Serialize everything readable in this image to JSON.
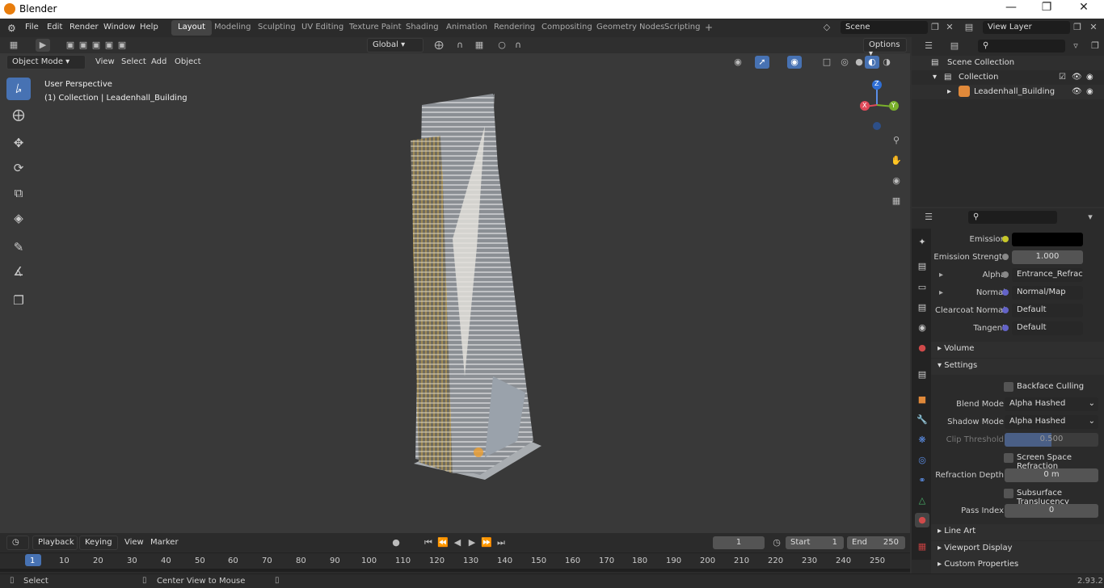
{
  "app": {
    "title": "Blender",
    "version": "2.93.2"
  },
  "menus": [
    "File",
    "Edit",
    "Render",
    "Window",
    "Help"
  ],
  "workspaces": [
    "Layout",
    "Modeling",
    "Sculpting",
    "UV Editing",
    "Texture Paint",
    "Shading",
    "Animation",
    "Rendering",
    "Compositing",
    "Geometry Nodes",
    "Scripting"
  ],
  "active_workspace": "Layout",
  "scene": {
    "name": "Scene",
    "view_layer": "View Layer"
  },
  "header": {
    "transform": "Global",
    "options": "Options"
  },
  "viewport": {
    "mode": "Object Mode",
    "menu": [
      "View",
      "Select",
      "Add",
      "Object"
    ],
    "perspective": "User Perspective",
    "collection_info": "(1) Collection | Leadenhall_Building",
    "gizmo": {
      "x": "X",
      "y": "Y",
      "z": "Z"
    }
  },
  "outliner": {
    "root": "Scene Collection",
    "collection": "Collection",
    "object": "Leadenhall_Building"
  },
  "properties": {
    "emission_label": "Emission",
    "emission_strength_label": "Emission Strengt",
    "emission_strength_value": "1.000",
    "alpha_label": "Alpha",
    "alpha_value": "Entrance_Refract_in...",
    "normal_label": "Normal",
    "normal_value": "Normal/Map",
    "clearcoat_label": "Clearcoat Normal",
    "clearcoat_value": "Default",
    "tangent_label": "Tangent",
    "tangent_value": "Default",
    "volume": "Volume",
    "settings": "Settings",
    "backface": "Backface Culling",
    "blend_label": "Blend Mode",
    "blend_value": "Alpha Hashed",
    "shadow_label": "Shadow Mode",
    "shadow_value": "Alpha Hashed",
    "clip_label": "Clip Threshold",
    "clip_value": "0.500",
    "ssr": "Screen Space Refraction",
    "refraction_label": "Refraction Depth",
    "refraction_value": "0 m",
    "sss": "Subsurface Translucency",
    "pass_label": "Pass Index",
    "pass_value": "0",
    "line_art": "Line Art",
    "viewport_display": "Viewport Display",
    "custom_props": "Custom Properties"
  },
  "timeline": {
    "menus": [
      "Playback",
      "Keying",
      "View",
      "Marker"
    ],
    "current_frame": "1",
    "start_label": "Start",
    "start": "1",
    "end_label": "End",
    "end": "250",
    "ticks": [
      "1",
      "10",
      "20",
      "30",
      "40",
      "50",
      "60",
      "70",
      "80",
      "90",
      "100",
      "110",
      "120",
      "130",
      "140",
      "150",
      "160",
      "170",
      "180",
      "190",
      "200",
      "210",
      "220",
      "230",
      "240",
      "250"
    ]
  },
  "status": {
    "select": "Select",
    "center_view": "Center View to Mouse"
  }
}
